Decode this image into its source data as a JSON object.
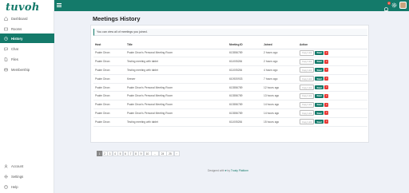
{
  "app": {
    "logo_text": "tuvoh"
  },
  "sidebar": {
    "items": [
      {
        "label": "Dashboard",
        "icon": "home-icon"
      },
      {
        "label": "Rooms",
        "icon": "rooms-icon"
      },
      {
        "label": "History",
        "icon": "history-icon",
        "active": true
      },
      {
        "label": "Chat",
        "icon": "chat-icon"
      },
      {
        "label": "Files",
        "icon": "files-icon"
      },
      {
        "label": "Membership",
        "icon": "membership-icon"
      }
    ],
    "bottom_items": [
      {
        "label": "Account",
        "icon": "account-icon"
      },
      {
        "label": "Settings",
        "icon": "settings-icon"
      },
      {
        "label": "Help",
        "icon": "help-icon"
      }
    ]
  },
  "topbar": {
    "notification_count": "2"
  },
  "main": {
    "title": "Meetings History",
    "alert": "You can view all of meetings you joined.",
    "table": {
      "columns": [
        "Host",
        "Title",
        "Meeting ID",
        "Joined",
        "Action"
      ],
      "rows": [
        [
          "Psalm Dixon",
          "Psalm Dixon's Personal Meeting Room",
          "613556789",
          "2 hours ago"
        ],
        [
          "Psalm Dixon",
          "Testing meeting with tablet",
          "611005284",
          "2 hours ago"
        ],
        [
          "Psalm Dixon",
          "Testing meeting with tablet",
          "611005284",
          "4 hours ago"
        ],
        [
          "Psalm Dixon",
          "Keezer",
          "610920933",
          "7 hours ago"
        ],
        [
          "Psalm Dixon",
          "Psalm Dixon's Personal Meeting Room",
          "613556789",
          "12 hours ago"
        ],
        [
          "Psalm Dixon",
          "Psalm Dixon's Personal Meeting Room",
          "613556789",
          "13 hours ago"
        ],
        [
          "Psalm Dixon",
          "Psalm Dixon's Personal Meeting Room",
          "613556789",
          "14 hours ago"
        ],
        [
          "Psalm Dixon",
          "Psalm Dixon's Personal Meeting Room",
          "613556789",
          "14 hours ago"
        ],
        [
          "Psalm Dixon",
          "Testing meeting with tablet",
          "611005284",
          "15 hours ago"
        ]
      ],
      "copy_label": "Copy Link",
      "start_label": "Start",
      "delete_label": "×"
    },
    "pagination": [
      "1",
      "2",
      "3",
      "4",
      "5",
      "6",
      "7",
      "8",
      "9",
      "10",
      "...",
      "24",
      "25",
      "›"
    ]
  },
  "footer": {
    "prefix": "Designed with",
    "heart": "♥",
    "by": "by",
    "brand": "Trusty Platform"
  },
  "colors": {
    "accent": "#147a6a",
    "danger": "#e53935",
    "background": "#eef1f7"
  }
}
